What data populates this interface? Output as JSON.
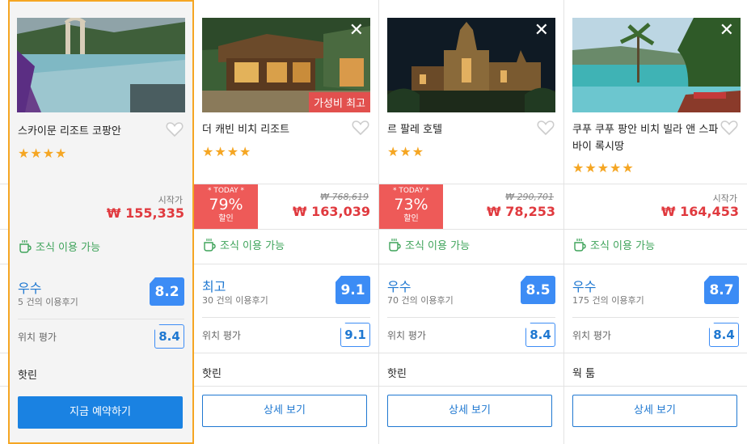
{
  "hotels": [
    {
      "name": "스카이문 리조트 코팡안",
      "stars": "★★★★",
      "price_label": "시작가",
      "price": "₩ 155,335",
      "breakfast": "조식 이용 가능",
      "rating_word": "우수",
      "review_count": "5 건의 이용후기",
      "score": "8.2",
      "location_label": "위치 평가",
      "location_score": "8.4",
      "area": "핫린",
      "button": "지금 예약하기"
    },
    {
      "name": "더 캐빈 비치 리조트",
      "stars": "★★★★",
      "badge": "가성비 최고",
      "close": "✕",
      "today_label": "* TODAY *",
      "discount": "79%",
      "discount_word": "할인",
      "old_price": "₩ 768,619",
      "price": "₩ 163,039",
      "breakfast": "조식 이용 가능",
      "rating_word": "최고",
      "review_count": "30 건의 이용후기",
      "score": "9.1",
      "location_label": "위치 평가",
      "location_score": "9.1",
      "area": "핫린",
      "button": "상세 보기"
    },
    {
      "name": "르 팔레 호텔",
      "stars": "★★★",
      "close": "✕",
      "today_label": "* TODAY *",
      "discount": "73%",
      "discount_word": "할인",
      "old_price": "₩ 290,701",
      "price": "₩ 78,253",
      "breakfast": "조식 이용 가능",
      "rating_word": "우수",
      "review_count": "70 건의 이용후기",
      "score": "8.5",
      "location_label": "위치 평가",
      "location_score": "8.4",
      "area": "핫린",
      "button": "상세 보기"
    },
    {
      "name": "쿠푸 쿠푸 팡안 비치 빌라 앤 스파 바이 록시땅",
      "stars": "★★★★★",
      "close": "✕",
      "price_label": "시작가",
      "price": "₩ 164,453",
      "breakfast": "조식 이용 가능",
      "rating_word": "우수",
      "review_count": "175 건의 이용후기",
      "score": "8.7",
      "location_label": "위치 평가",
      "location_score": "8.4",
      "area": "웍 툼",
      "button": "상세 보기"
    }
  ],
  "colors": {
    "accent": "#1a82e2",
    "selected_border": "#f5a623",
    "price": "#e0393e",
    "discount_bg": "#ee5a58",
    "breakfast": "#3ea35a",
    "star": "#f5a623"
  },
  "icons": [
    "heart-icon",
    "close-icon",
    "coffee-cup-icon"
  ]
}
